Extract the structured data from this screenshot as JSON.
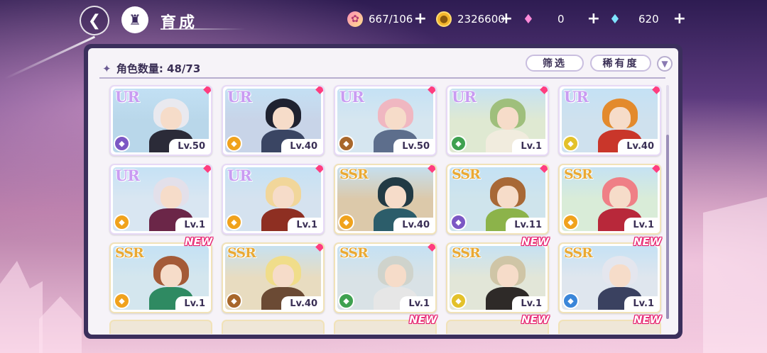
{
  "header": {
    "title": "育成",
    "back_label": "←",
    "resources": [
      {
        "name": "candy",
        "value": "667/106",
        "icon": "candy-icon"
      },
      {
        "name": "coin",
        "value": "2326600",
        "icon": "coin-icon"
      },
      {
        "name": "pink-gem",
        "value": "0",
        "icon": "pink-gem-icon"
      },
      {
        "name": "diamond",
        "value": "620",
        "icon": "diamond-icon"
      }
    ],
    "plus": "+"
  },
  "panel": {
    "count_label": "角色数量:",
    "count_value": "48/73",
    "filter_label": "筛选",
    "rarity_label": "稀有度",
    "sort_icon": "chevron-down-icon"
  },
  "cards": [
    {
      "rarity": "UR",
      "level": "Lv.50",
      "attr_color": "purple",
      "hair": "#e9e9ef",
      "outfit": "#2b2b38",
      "bg": "#b9d7ea",
      "new": false,
      "marker": true
    },
    {
      "rarity": "UR",
      "level": "Lv.40",
      "attr_color": "orange",
      "hair": "#1f2230",
      "outfit": "#3a4563",
      "bg": "#c8d4e8",
      "new": false,
      "marker": true
    },
    {
      "rarity": "UR",
      "level": "Lv.50",
      "attr_color": "brown",
      "hair": "#f0b7c1",
      "outfit": "#5d6e8c",
      "bg": "#d6e6f0",
      "new": false,
      "marker": true
    },
    {
      "rarity": "UR",
      "level": "Lv.1",
      "attr_color": "green",
      "hair": "#9fbf7c",
      "outfit": "#f1ecde",
      "bg": "#dfe9d2",
      "new": false,
      "marker": true
    },
    {
      "rarity": "UR",
      "level": "Lv.40",
      "attr_color": "yellow",
      "hair": "#e38a2c",
      "outfit": "#c9362a",
      "bg": "#cfe1ee",
      "new": false,
      "marker": true
    },
    {
      "rarity": "UR",
      "level": "Lv.1",
      "attr_color": "orange",
      "hair": "#e3e0ea",
      "outfit": "#6b2648",
      "bg": "#d9e6f2",
      "new": false,
      "marker": true
    },
    {
      "rarity": "UR",
      "level": "Lv.1",
      "attr_color": "orange",
      "hair": "#f1d69a",
      "outfit": "#8e2f22",
      "bg": "#d5e2ef",
      "new": false,
      "marker": true
    },
    {
      "rarity": "SSR",
      "level": "Lv.40",
      "attr_color": "orange",
      "hair": "#223a44",
      "outfit": "#2c5d6a",
      "bg": "#dcc9aa",
      "new": false,
      "marker": true
    },
    {
      "rarity": "SSR",
      "level": "Lv.11",
      "attr_color": "purple",
      "hair": "#a86836",
      "outfit": "#8cb34a",
      "bg": "#cfe4ec",
      "new": false,
      "marker": true
    },
    {
      "rarity": "SSR",
      "level": "Lv.1",
      "attr_color": "orange",
      "hair": "#ef7f86",
      "outfit": "#b8283a",
      "bg": "#d9ecd8",
      "new": false,
      "marker": true
    },
    {
      "rarity": "SSR",
      "level": "Lv.1",
      "attr_color": "orange",
      "hair": "#a45a37",
      "outfit": "#2f8a62",
      "bg": "#d4e6ee",
      "new": true,
      "marker": false
    },
    {
      "rarity": "SSR",
      "level": "Lv.40",
      "attr_color": "brown",
      "hair": "#f0dd8a",
      "outfit": "#6b4a34",
      "bg": "#e8dcc0",
      "new": false,
      "marker": true
    },
    {
      "rarity": "SSR",
      "level": "Lv.1",
      "attr_color": "green",
      "hair": "#cfd3cc",
      "outfit": "#e6e6e6",
      "bg": "#d9e2e6",
      "new": false,
      "marker": true
    },
    {
      "rarity": "SSR",
      "level": "Lv.1",
      "attr_color": "yellow",
      "hair": "#cfc5a6",
      "outfit": "#2e2a28",
      "bg": "#e2e6d8",
      "new": true,
      "marker": false
    },
    {
      "rarity": "SSR",
      "level": "Lv.1",
      "attr_color": "blue",
      "hair": "#e4e6ee",
      "outfit": "#3a4160",
      "bg": "#dfe6ee",
      "new": true,
      "marker": false
    }
  ],
  "new_label": "NEW",
  "peek_cards": [
    {
      "new": false,
      "marker": true
    },
    {
      "new": false,
      "marker": true
    },
    {
      "new": true,
      "marker": false
    },
    {
      "new": true,
      "marker": false
    },
    {
      "new": true,
      "marker": false
    }
  ]
}
